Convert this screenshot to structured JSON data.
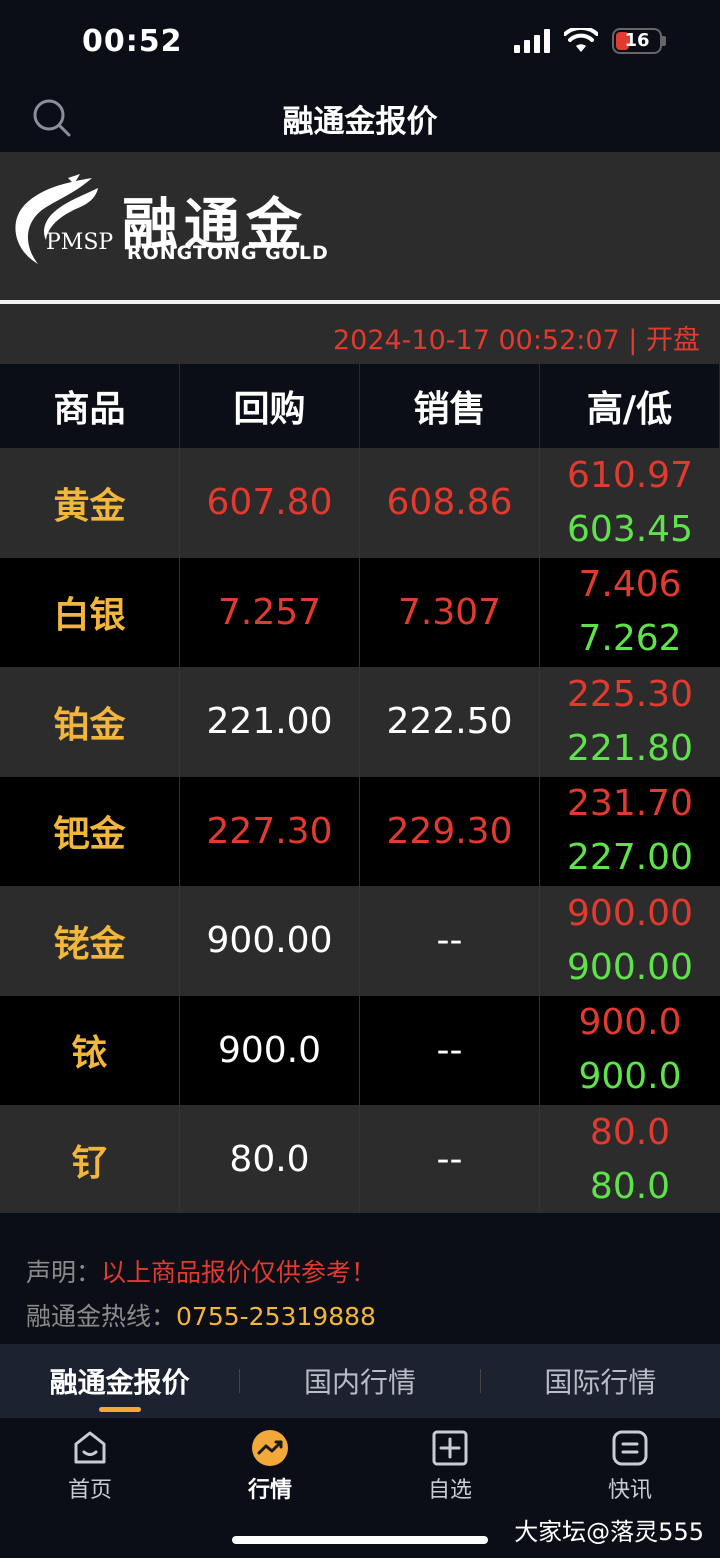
{
  "status": {
    "time": "00:52",
    "battery": "16"
  },
  "nav": {
    "title": "融通金报价"
  },
  "logo": {
    "pmsp": "PMSP",
    "cn": "融通金",
    "en": "RONGTONG GOLD"
  },
  "timestamp": "2024-10-17 00:52:07 | 开盘",
  "table": {
    "headers": [
      "商品",
      "回购",
      "销售",
      "高/低"
    ],
    "rows": [
      {
        "name": "黄金",
        "buy": "607.80",
        "sell": "608.86",
        "high": "610.97",
        "low": "603.45"
      },
      {
        "name": "白银",
        "buy": "7.257",
        "sell": "7.307",
        "high": "7.406",
        "low": "7.262"
      },
      {
        "name": "铂金",
        "buy": "221.00",
        "sell": "222.50",
        "high": "225.30",
        "low": "221.80"
      },
      {
        "name": "钯金",
        "buy": "227.30",
        "sell": "229.30",
        "high": "231.70",
        "low": "227.00"
      },
      {
        "name": "铑金",
        "buy": "900.00",
        "sell": "--",
        "high": "900.00",
        "low": "900.00"
      },
      {
        "name": "铱",
        "buy": "900.0",
        "sell": "--",
        "high": "900.0",
        "low": "900.0"
      },
      {
        "name": "钌",
        "buy": "80.0",
        "sell": "--",
        "high": "80.0",
        "low": "80.0"
      }
    ]
  },
  "notice": {
    "label": "声明：",
    "text": "以上商品报价仅供参考！",
    "hotline_label": "融通金热线：",
    "hotline": "0755-25319888"
  },
  "tabs": [
    "融通金报价",
    "国内行情",
    "国际行情"
  ],
  "bottom_nav": [
    "首页",
    "行情",
    "自选",
    "快讯"
  ],
  "watermark": "大家坛@落灵555",
  "colors": {
    "red": "#e23a2e",
    "green": "#5ee34a",
    "gold": "#f2b63a",
    "accent": "#f2a93a"
  }
}
